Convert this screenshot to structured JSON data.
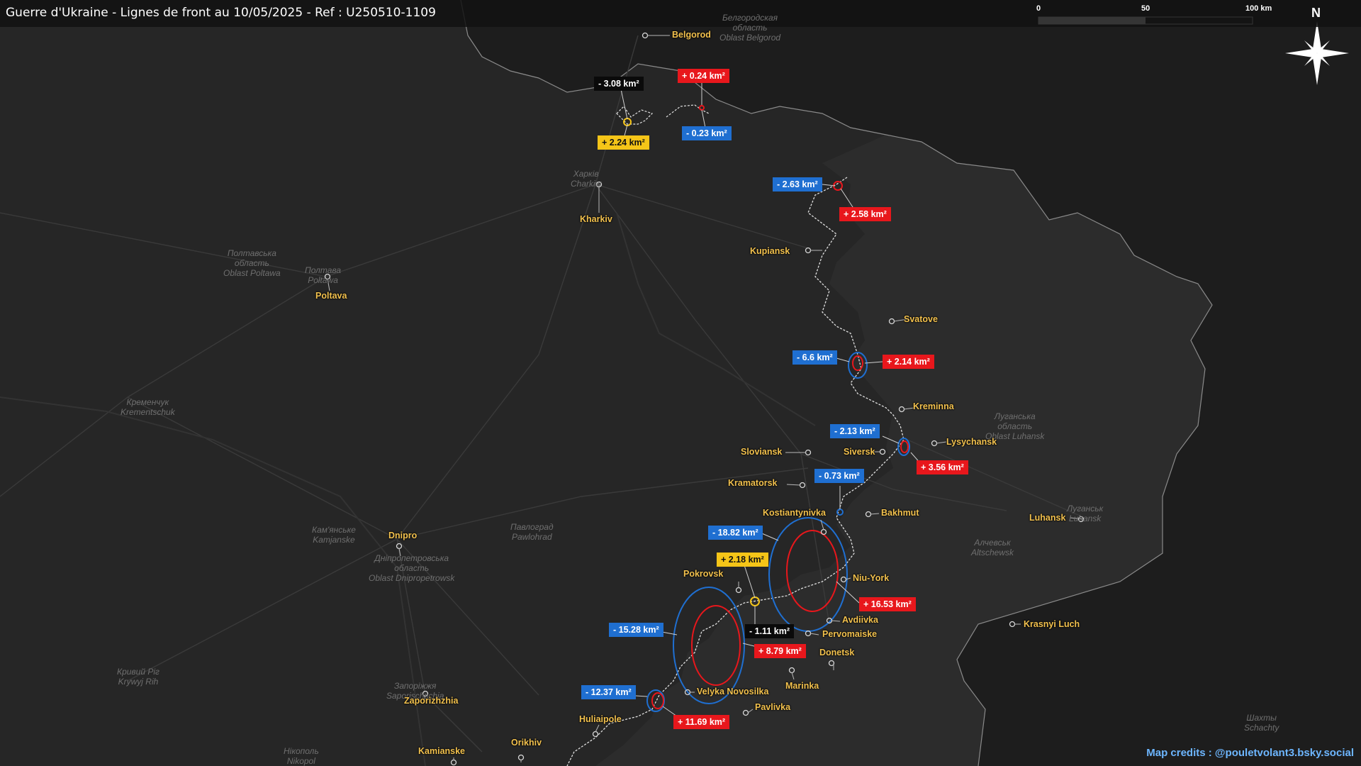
{
  "title": "Guerre d'Ukraine - Lignes de front au 10/05/2025 - Ref : U250510-1109",
  "scale": {
    "labels": [
      "0",
      "50",
      "100 km"
    ]
  },
  "north_label": "N",
  "credits": "Map credits : @pouletvolant3.bsky.social",
  "cities": [
    "Belgorod",
    "Kharkiv",
    "Kupiansk",
    "Poltava",
    "Svatove",
    "Kreminna",
    "Lysychansk",
    "Sloviansk",
    "Siversk",
    "Kramatorsk",
    "Kostiantynivka",
    "Bakhmut",
    "Luhansk",
    "Dnipro",
    "Pokrovsk",
    "Niu-York",
    "Avdiivka",
    "Pervomaiske",
    "Donetsk",
    "Krasnyi Luch",
    "Marinka",
    "Velyka Novosilka",
    "Pavlivka",
    "Zaporizhzhia",
    "Huliaipole",
    "Orikhiv",
    "Kamianske"
  ],
  "regions": [
    "Белгородская\nобласть\nOblast Belgorod",
    "Харків\nCharkiw",
    "Полтавська\nобласть\nOblast Poltawa",
    "Полтава\nPoltawa",
    "Кременчук\nKrementschuk",
    "Кам'янське\nKamjanske",
    "Павлоград\nPawlohrad",
    "Дніпропетровська\nобласть\nOblast Dnipropetrowsk",
    "Луганська\nобласть\nOblast Luhansk",
    "Алчевськ\nAltschewsk",
    "Кривий Ріг\nKrywyj Rih",
    "Шахты\nSchachty",
    "Нікополь\nNikopol",
    "Луганськ\nLuhansk",
    "Запоріжжя\nSaporischschja"
  ],
  "changes": [
    {
      "label": "- 3.08 km²",
      "color": "black"
    },
    {
      "label": "+ 2.24 km²",
      "color": "yellow"
    },
    {
      "label": "+ 0.24 km²",
      "color": "red"
    },
    {
      "label": "- 0.23 km²",
      "color": "blue"
    },
    {
      "label": "- 2.63 km²",
      "color": "blue"
    },
    {
      "label": "+ 2.58 km²",
      "color": "red"
    },
    {
      "label": "- 6.6 km²",
      "color": "blue"
    },
    {
      "label": "+ 2.14 km²",
      "color": "red"
    },
    {
      "label": "- 2.13 km²",
      "color": "blue"
    },
    {
      "label": "+ 3.56 km²",
      "color": "red"
    },
    {
      "label": "- 0.73 km²",
      "color": "blue"
    },
    {
      "label": "- 18.82 km²",
      "color": "blue"
    },
    {
      "label": "+ 2.18 km²",
      "color": "yellow"
    },
    {
      "label": "+ 16.53 km²",
      "color": "red"
    },
    {
      "label": "- 15.28 km²",
      "color": "blue"
    },
    {
      "label": "- 1.11 km²",
      "color": "black"
    },
    {
      "label": "+ 8.79 km²",
      "color": "red"
    },
    {
      "label": "- 12.37 km²",
      "color": "blue"
    },
    {
      "label": "+ 11.69 km²",
      "color": "red"
    }
  ],
  "colors": {
    "background": "#262626",
    "city": "#f2c14e",
    "gain": "#e8171c",
    "loss": "#1f6fd1",
    "neutral": "#0a0a0a",
    "other": "#f5c518",
    "credits": "#6db6ff"
  }
}
